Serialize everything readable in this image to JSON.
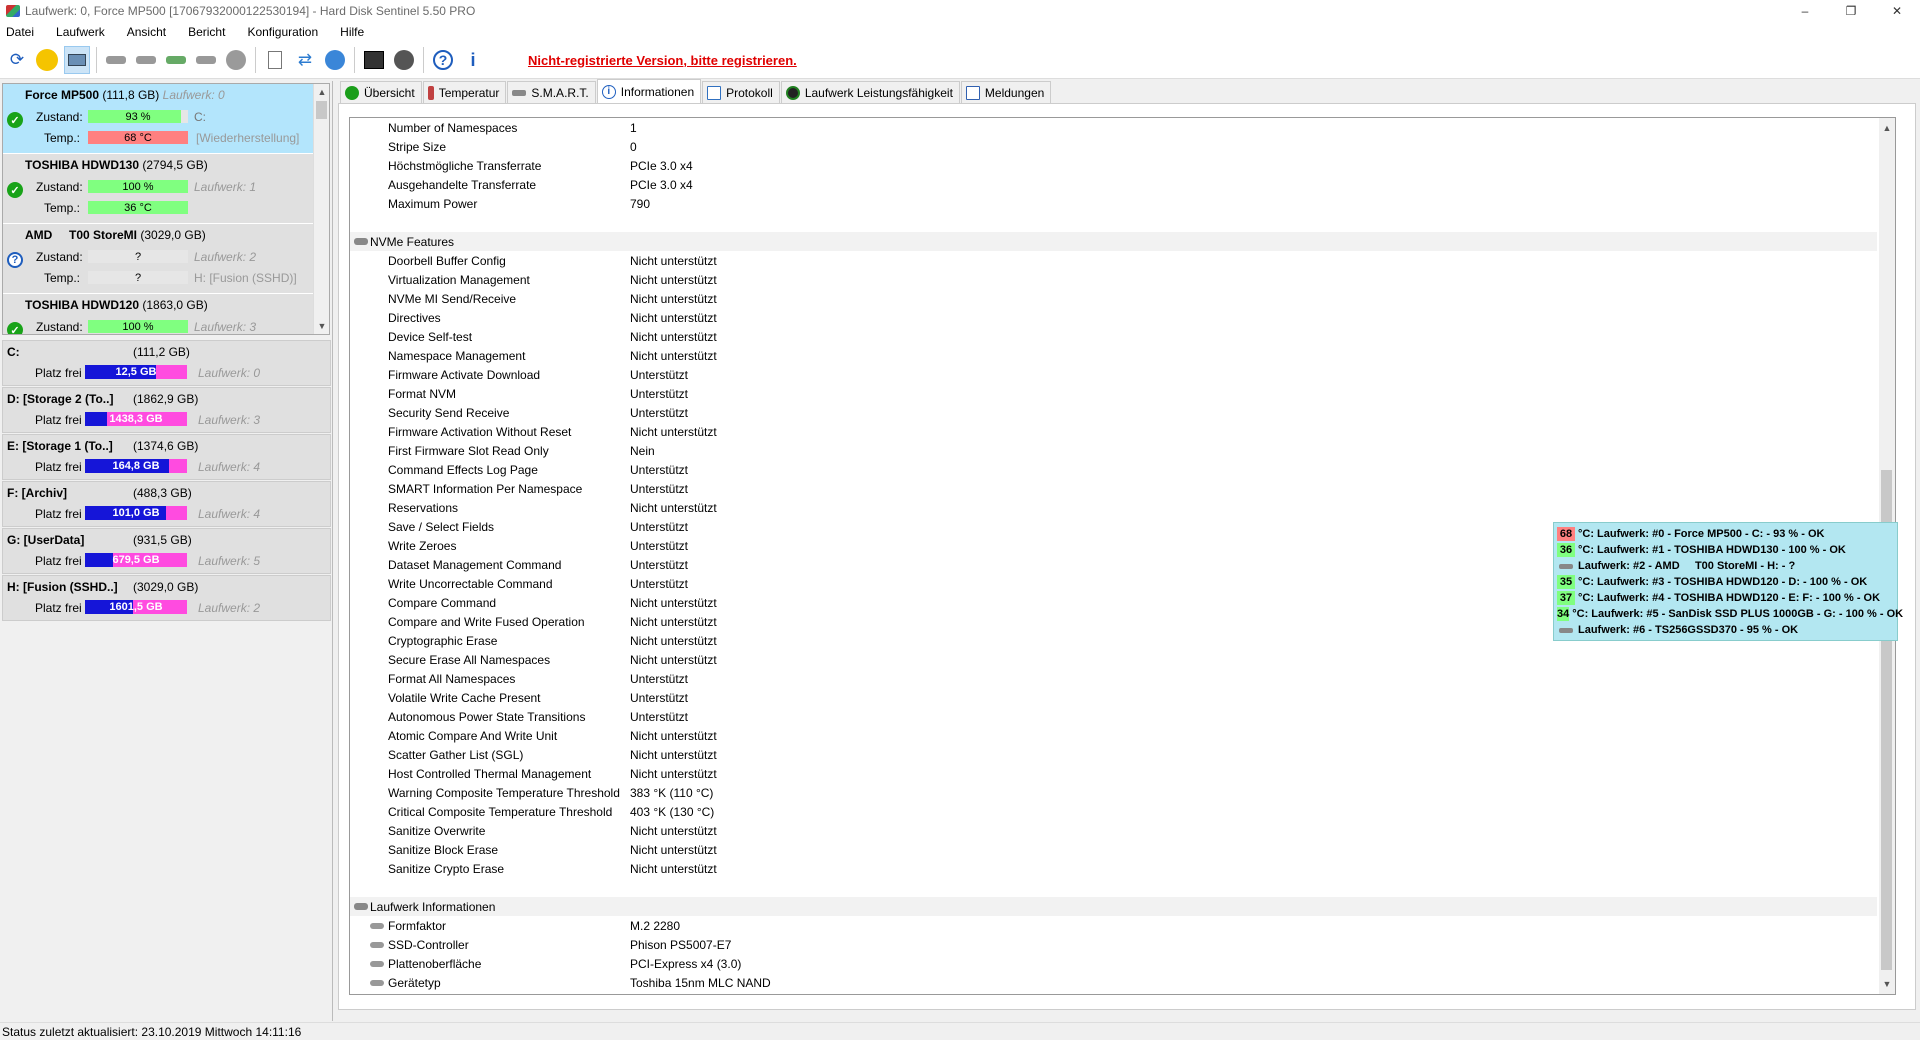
{
  "window": {
    "title": "Laufwerk: 0, Force MP500 [17067932000122530194]  -  Hard Disk Sentinel 5.50 PRO",
    "controls": [
      "–",
      "❐",
      "✕"
    ]
  },
  "menu": [
    "Datei",
    "Laufwerk",
    "Ansicht",
    "Bericht",
    "Konfiguration",
    "Hilfe"
  ],
  "toolbar": {
    "registration_notice": "Nicht-registrierte Version, bitte registrieren."
  },
  "disks": [
    {
      "name": "Force MP500",
      "size": "(111,8 GB)",
      "drive": "Laufwerk: 0",
      "status": "ok",
      "zustand_label": "Zustand:",
      "zustand": "93 %",
      "health_pct": 93,
      "temp_label": "Temp.:",
      "temp": "68 °C",
      "temp_hot": true,
      "aux1": "C:",
      "aux2": "[Wiederherstellung]"
    },
    {
      "name": "TOSHIBA HDWD130",
      "size": "(2794,5 GB)",
      "drive": "",
      "status": "ok",
      "zustand_label": "Zustand:",
      "zustand": "100 %",
      "health_pct": 100,
      "temp_label": "Temp.:",
      "temp": "36 °C",
      "temp_hot": false,
      "aux1": "Laufwerk: 1",
      "aux2": ""
    },
    {
      "name": "AMD     T00 StoreMI",
      "size": "(3029,0 GB)",
      "drive": "",
      "status": "unknown",
      "zustand_label": "Zustand:",
      "zustand": "?",
      "health_pct": 0,
      "temp_label": "Temp.:",
      "temp": "?",
      "temp_hot": false,
      "aux1": "Laufwerk: 2",
      "aux2": "H: [Fusion (SSHD)]"
    },
    {
      "name": "TOSHIBA HDWD120",
      "size": "(1863,0 GB)",
      "drive": "",
      "status": "ok",
      "zustand_label": "Zustand:",
      "zustand": "100 %",
      "health_pct": 100,
      "temp_label": "",
      "temp": "",
      "temp_hot": false,
      "aux1": "Laufwerk: 3",
      "aux2": ""
    }
  ],
  "volumes": [
    {
      "name": "C:",
      "size": "(111,2 GB)",
      "free_label": "Platz frei",
      "free": "12,5 GB",
      "free_frac": 0.11,
      "drive": "Laufwerk: 0"
    },
    {
      "name": "D: [Storage 2 (To..]",
      "size": "(1862,9 GB)",
      "free_label": "Platz frei",
      "free": "1438,3 GB",
      "free_frac": 0.77,
      "drive": "Laufwerk: 3"
    },
    {
      "name": "E: [Storage 1 (To..]",
      "size": "(1374,6 GB)",
      "free_label": "Platz frei",
      "free": "164,8 GB",
      "free_frac": 0.12,
      "drive": "Laufwerk: 4"
    },
    {
      "name": "F: [Archiv]",
      "size": "(488,3 GB)",
      "free_label": "Platz frei",
      "free": "101,0 GB",
      "free_frac": 0.21,
      "drive": "Laufwerk: 4"
    },
    {
      "name": "G: [UserData]",
      "size": "(931,5 GB)",
      "free_label": "Platz frei",
      "free": "679,5 GB",
      "free_frac": 0.73,
      "drive": "Laufwerk: 5"
    },
    {
      "name": "H: [Fusion (SSHD..]",
      "size": "(3029,0 GB)",
      "free_label": "Platz frei",
      "free": "1601,5 GB",
      "free_frac": 0.53,
      "drive": "Laufwerk: 2"
    }
  ],
  "tabs": [
    {
      "label": "Übersicht",
      "color": "#1a9e1a"
    },
    {
      "label": "Temperatur",
      "color": "#c04040"
    },
    {
      "label": "S.M.A.R.T.",
      "color": "#888888"
    },
    {
      "label": "Informationen",
      "color": "#2060c0"
    },
    {
      "label": "Protokoll",
      "color": "#3070c0"
    },
    {
      "label": "Laufwerk Leistungsfähigkeit",
      "color": "#208020"
    },
    {
      "label": "Meldungen",
      "color": "#3060b0"
    }
  ],
  "active_tab": 3,
  "info_top": [
    {
      "k": "Number of Namespaces",
      "v": "1"
    },
    {
      "k": "Stripe Size",
      "v": "0"
    },
    {
      "k": "Höchstmögliche Transferrate",
      "v": "PCIe 3.0 x4"
    },
    {
      "k": "Ausgehandelte Transferrate",
      "v": "PCIe 3.0 x4"
    },
    {
      "k": "Maximum Power",
      "v": "790"
    }
  ],
  "nvme_section": "NVMe Features",
  "nvme_features": [
    {
      "k": "Doorbell Buffer Config",
      "v": "Nicht unterstützt"
    },
    {
      "k": "Virtualization Management",
      "v": "Nicht unterstützt"
    },
    {
      "k": "NVMe MI Send/Receive",
      "v": "Nicht unterstützt"
    },
    {
      "k": "Directives",
      "v": "Nicht unterstützt"
    },
    {
      "k": "Device Self-test",
      "v": "Nicht unterstützt"
    },
    {
      "k": "Namespace Management",
      "v": "Nicht unterstützt"
    },
    {
      "k": "Firmware Activate Download",
      "v": "Unterstützt"
    },
    {
      "k": "Format NVM",
      "v": "Unterstützt"
    },
    {
      "k": "Security Send Receive",
      "v": "Unterstützt"
    },
    {
      "k": "Firmware Activation Without Reset",
      "v": "Nicht unterstützt"
    },
    {
      "k": "First Firmware Slot Read Only",
      "v": "Nein"
    },
    {
      "k": "Command Effects Log Page",
      "v": "Unterstützt"
    },
    {
      "k": "SMART Information Per Namespace",
      "v": "Unterstützt"
    },
    {
      "k": "Reservations",
      "v": "Nicht unterstützt"
    },
    {
      "k": "Save / Select Fields",
      "v": "Unterstützt"
    },
    {
      "k": "Write Zeroes",
      "v": "Unterstützt"
    },
    {
      "k": "Dataset Management Command",
      "v": "Unterstützt"
    },
    {
      "k": "Write Uncorrectable Command",
      "v": "Unterstützt"
    },
    {
      "k": "Compare Command",
      "v": "Nicht unterstützt"
    },
    {
      "k": "Compare and Write Fused Operation",
      "v": "Nicht unterstützt"
    },
    {
      "k": "Cryptographic Erase",
      "v": "Nicht unterstützt"
    },
    {
      "k": "Secure Erase All Namespaces",
      "v": "Nicht unterstützt"
    },
    {
      "k": "Format All Namespaces",
      "v": "Unterstützt"
    },
    {
      "k": "Volatile Write Cache Present",
      "v": "Unterstützt"
    },
    {
      "k": "Autonomous Power State Transitions",
      "v": "Unterstützt"
    },
    {
      "k": "Atomic Compare And Write Unit",
      "v": "Nicht unterstützt"
    },
    {
      "k": "Scatter Gather List (SGL)",
      "v": "Nicht unterstützt"
    },
    {
      "k": "Host Controlled Thermal Management",
      "v": "Nicht unterstützt"
    },
    {
      "k": "Warning Composite Temperature Threshold",
      "v": "383 °K (110 °C)"
    },
    {
      "k": "Critical Composite Temperature Threshold",
      "v": "403 °K (130 °C)"
    },
    {
      "k": "Sanitize Overwrite",
      "v": "Nicht unterstützt"
    },
    {
      "k": "Sanitize Block Erase",
      "v": "Nicht unterstützt"
    },
    {
      "k": "Sanitize Crypto Erase",
      "v": "Nicht unterstützt"
    }
  ],
  "drive_section": "Laufwerk Informationen",
  "drive_info": [
    {
      "k": "Formfaktor",
      "v": "M.2 2280"
    },
    {
      "k": "SSD-Controller",
      "v": "Phison PS5007-E7"
    },
    {
      "k": "Plattenoberfläche",
      "v": "PCI-Express x4 (3.0)"
    },
    {
      "k": "Gerätetyp",
      "v": "Toshiba 15nm MLC NAND"
    }
  ],
  "tray_popup": [
    {
      "temp": "68",
      "cls": "hot",
      "text": "°C: Laufwerk: #0 - Force MP500 - C: - 93 % - OK"
    },
    {
      "temp": "36",
      "cls": "cool",
      "text": "°C: Laufwerk: #1 - TOSHIBA HDWD130 - 100 % - OK"
    },
    {
      "temp": "",
      "cls": "none",
      "text": "Laufwerk: #2 - AMD     T00 StoreMI - H: - ?"
    },
    {
      "temp": "35",
      "cls": "cool",
      "text": "°C: Laufwerk: #3 - TOSHIBA HDWD120 - D: - 100 % - OK"
    },
    {
      "temp": "37",
      "cls": "cool",
      "text": "°C: Laufwerk: #4 - TOSHIBA HDWD120 - E: F: - 100 % - OK"
    },
    {
      "temp": "34",
      "cls": "cool",
      "text": "°C: Laufwerk: #5 - SanDisk SSD PLUS 1000GB - G: - 100 % - OK"
    },
    {
      "temp": "",
      "cls": "none",
      "text": "Laufwerk: #6 - TS256GSSD370 - 95 % - OK"
    }
  ],
  "status_text": "Status zuletzt aktualisiert: 23.10.2019 Mittwoch 14:11:16"
}
